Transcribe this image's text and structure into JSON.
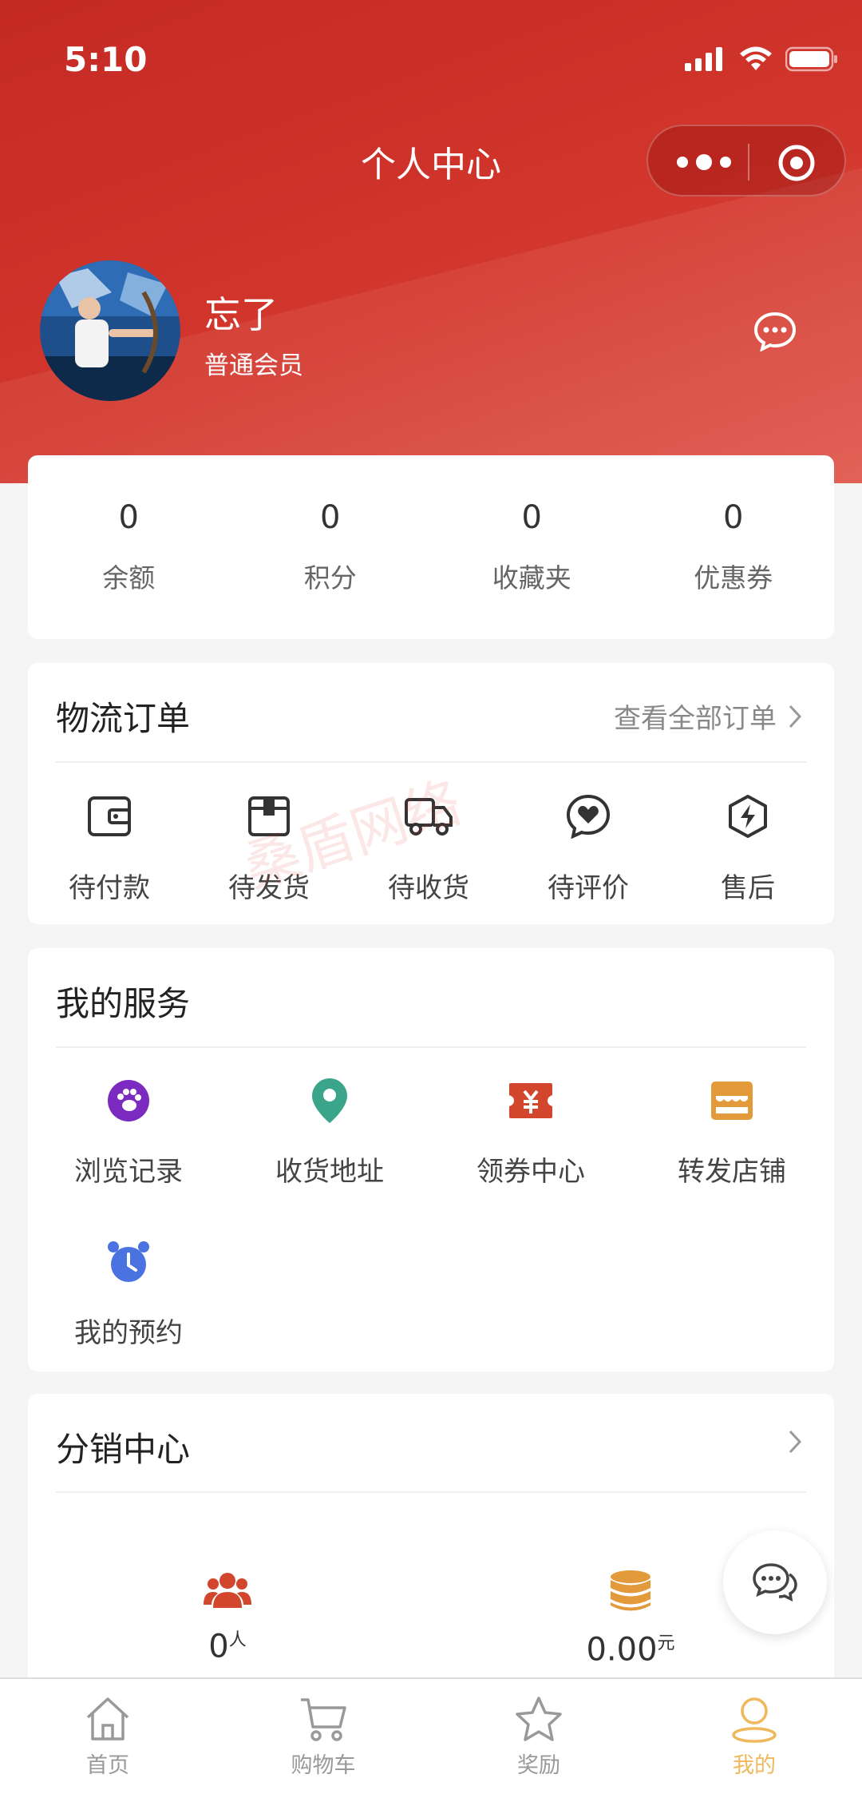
{
  "status_bar": {
    "time": "5:10"
  },
  "header": {
    "title": "个人中心"
  },
  "user": {
    "name": "忘了",
    "level": "普通会员"
  },
  "stats": [
    {
      "value": "0",
      "label": "余额"
    },
    {
      "value": "0",
      "label": "积分"
    },
    {
      "value": "0",
      "label": "收藏夹"
    },
    {
      "value": "0",
      "label": "优惠券"
    }
  ],
  "orders": {
    "title": "物流订单",
    "view_all": "查看全部订单",
    "items": [
      {
        "label": "待付款",
        "icon": "wallet-icon"
      },
      {
        "label": "待发货",
        "icon": "box-icon"
      },
      {
        "label": "待收货",
        "icon": "truck-icon"
      },
      {
        "label": "待评价",
        "icon": "heart-chat-icon"
      },
      {
        "label": "售后",
        "icon": "lightning-shield-icon"
      }
    ]
  },
  "services": {
    "title": "我的服务",
    "items": [
      {
        "label": "浏览记录",
        "icon": "footprint-icon",
        "color": "#7b2bbf"
      },
      {
        "label": "收货地址",
        "icon": "location-pin-icon",
        "color": "#3aa58a"
      },
      {
        "label": "领券中心",
        "icon": "coupon-icon",
        "color": "#d2462e"
      },
      {
        "label": "转发店铺",
        "icon": "store-icon",
        "color": "#e39a3b"
      },
      {
        "label": "我的预约",
        "icon": "alarm-clock-icon",
        "color": "#4a72e0"
      }
    ]
  },
  "distribution": {
    "title": "分销中心",
    "people": {
      "value": "0",
      "unit": "人"
    },
    "amount": {
      "value": "0.00",
      "unit": "元"
    }
  },
  "watermark": "桑盾网络",
  "tabbar": [
    {
      "label": "首页",
      "icon": "home-icon"
    },
    {
      "label": "购物车",
      "icon": "cart-icon"
    },
    {
      "label": "奖励",
      "icon": "star-icon"
    },
    {
      "label": "我的",
      "icon": "user-icon",
      "active": true
    }
  ],
  "colors": {
    "brand": "#c82b25",
    "active_tab": "#f0b85c"
  }
}
